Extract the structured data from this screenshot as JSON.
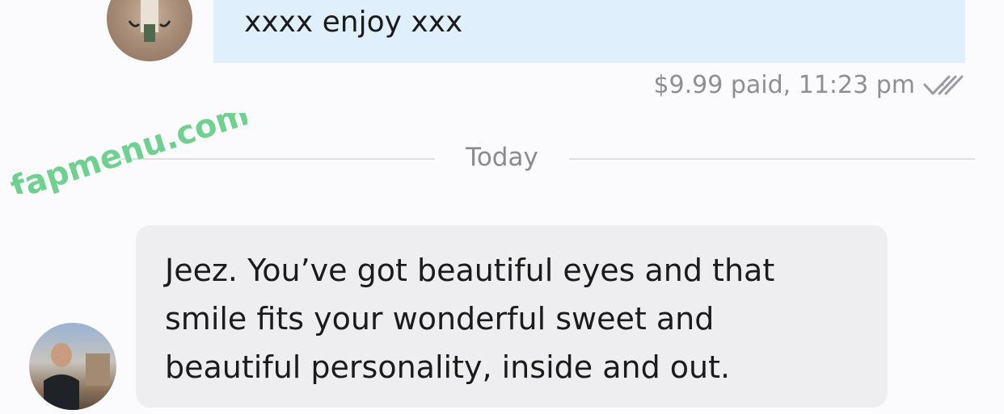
{
  "sent_message": {
    "text": "xxxx enjoy xxx",
    "meta": "$9.99 paid, 11:23 pm",
    "read_icon": "double-check-icon"
  },
  "date_separator": {
    "label": "Today"
  },
  "received_message": {
    "text": "Jeez. You’ve got beautiful eyes and that smile fits your wonderful sweet and beautiful personality, inside and out."
  },
  "watermark": {
    "text": "fapmenu.com",
    "color": "#6fd08f"
  },
  "colors": {
    "sent_bubble": "#dfeffb",
    "received_bubble": "#eeeef0",
    "meta_text": "#8e8e93"
  }
}
